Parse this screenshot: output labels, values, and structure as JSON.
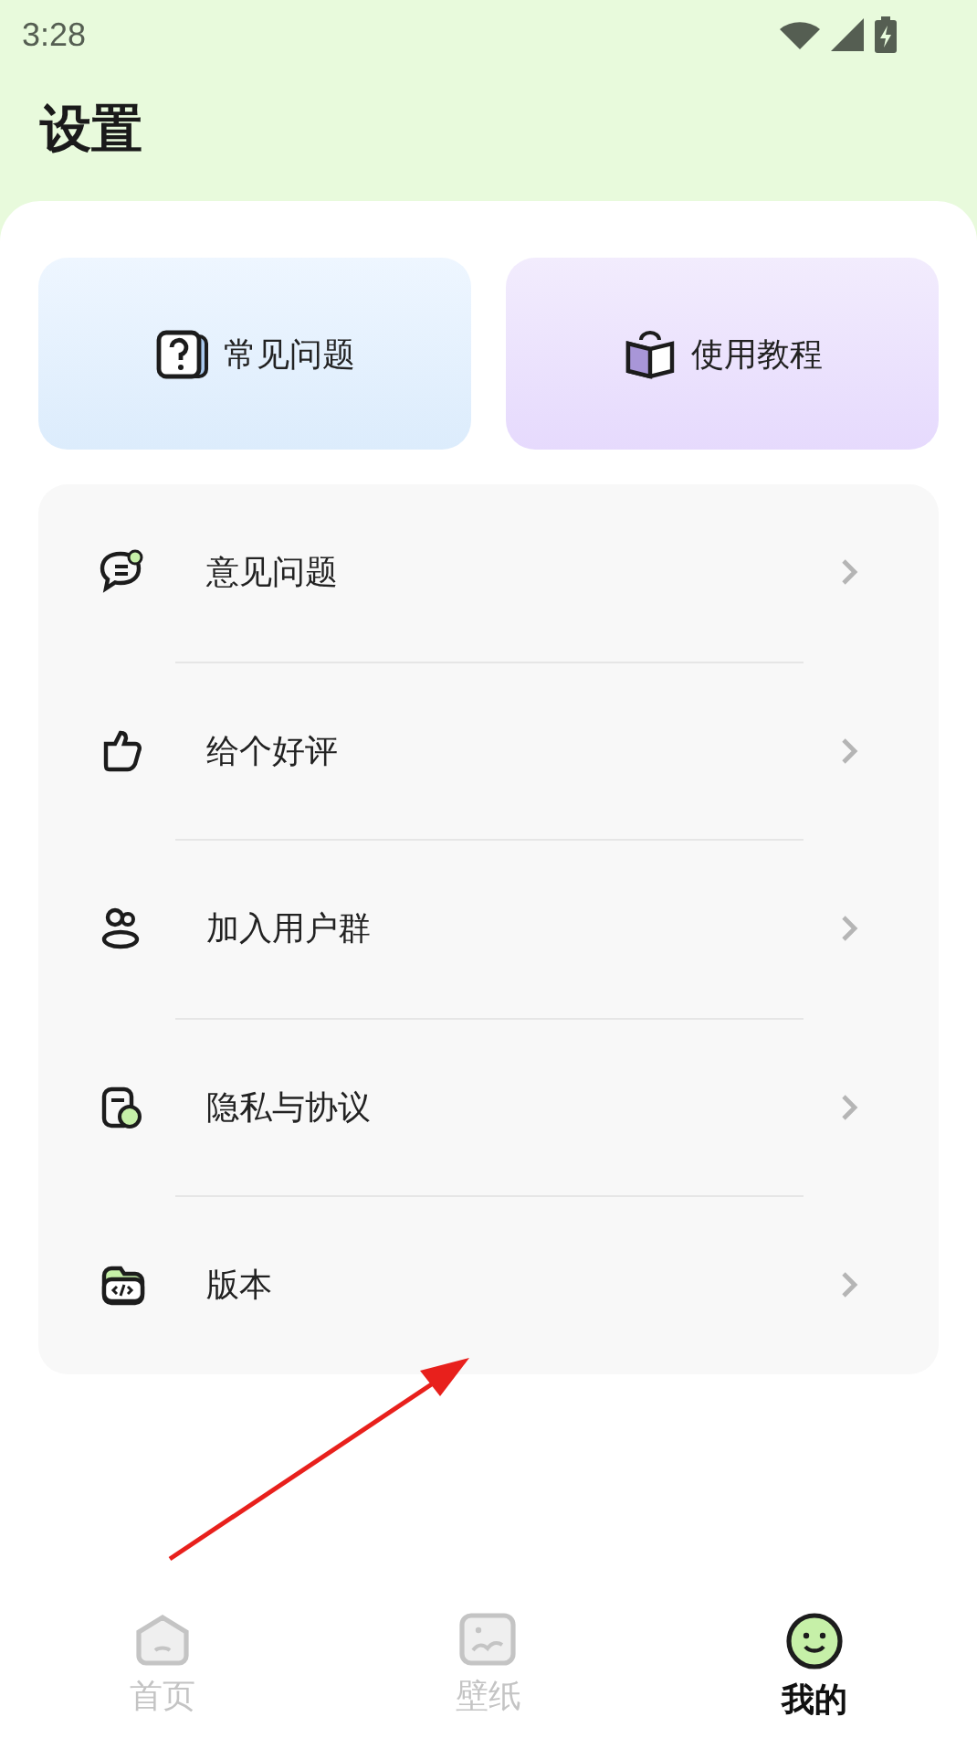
{
  "status_bar": {
    "time": "3:28"
  },
  "title": "设置",
  "quick_cards": [
    {
      "label": "常见问题",
      "kind": "faq"
    },
    {
      "label": "使用教程",
      "kind": "tutorial"
    }
  ],
  "menu_items": [
    {
      "label": "意见问题"
    },
    {
      "label": "给个好评"
    },
    {
      "label": "加入用户群"
    },
    {
      "label": "隐私与协议"
    },
    {
      "label": "版本"
    }
  ],
  "bottom_nav": [
    {
      "label": "首页",
      "selected": false
    },
    {
      "label": "壁纸",
      "selected": false
    },
    {
      "label": "我的",
      "selected": true
    }
  ]
}
